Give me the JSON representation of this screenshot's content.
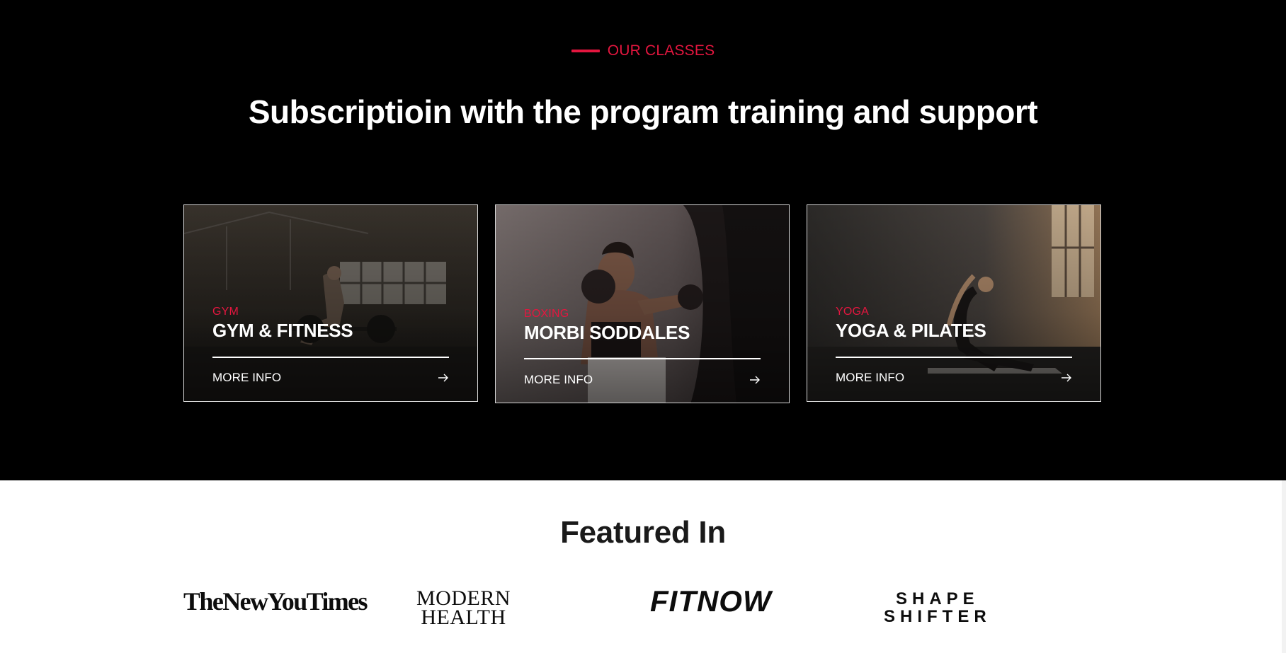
{
  "section": {
    "eyebrow": "OUR CLASSES",
    "headline": "Subscriptioin with the program training and support"
  },
  "cards": [
    {
      "category": "GYM",
      "title": "GYM & FITNESS",
      "more": "MORE INFO",
      "image": "woman deadlifting barbell in industrial gym"
    },
    {
      "category": "BOXING",
      "title": "MORBI SODDALES",
      "more": "MORE INFO",
      "image": "woman punching heavy bag"
    },
    {
      "category": "YOGA",
      "title": "YOGA & PILATES",
      "more": "MORE INFO",
      "image": "woman in yoga pose by window"
    }
  ],
  "featured": {
    "title": "Featured In",
    "logos": [
      "TheNewYouTimes",
      "MODERN",
      "HEALTH",
      "FITNOW",
      "SHAPE",
      "SHIFTER"
    ]
  },
  "colors": {
    "accent": "#e4163f",
    "dark_bg": "#000000",
    "light_bg": "#ffffff"
  },
  "icons": [
    "arrow-right-icon"
  ]
}
